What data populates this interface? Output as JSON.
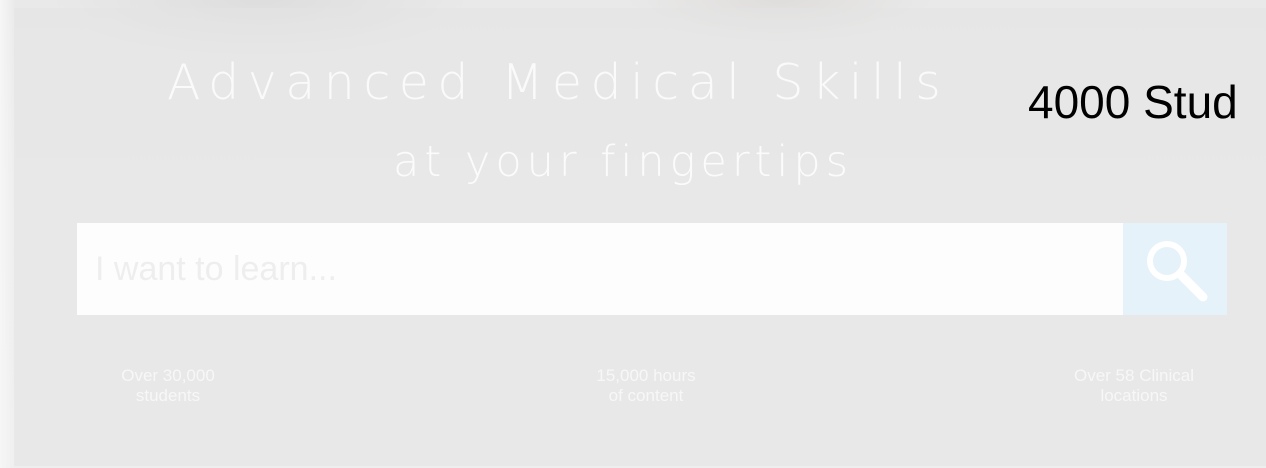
{
  "hero": {
    "title": "Advanced Medical Skills",
    "subtitle": "at your fingertips"
  },
  "overlay_text": "4000 Stud",
  "search": {
    "placeholder": "I want to learn...",
    "button_icon": "search-icon"
  },
  "stats": [
    {
      "line1": "Over 30,000",
      "line2": "students"
    },
    {
      "line1": "15,000 hours",
      "line2": "of content"
    },
    {
      "line1": "Over 58 Clinical",
      "line2": "locations"
    }
  ],
  "colors": {
    "overlay": "#e4e4e4",
    "hero_text": "#fafafa",
    "search_button_bg": "#e6f2f9",
    "search_icon": "#ffffff",
    "overlay_text": "#000000"
  }
}
